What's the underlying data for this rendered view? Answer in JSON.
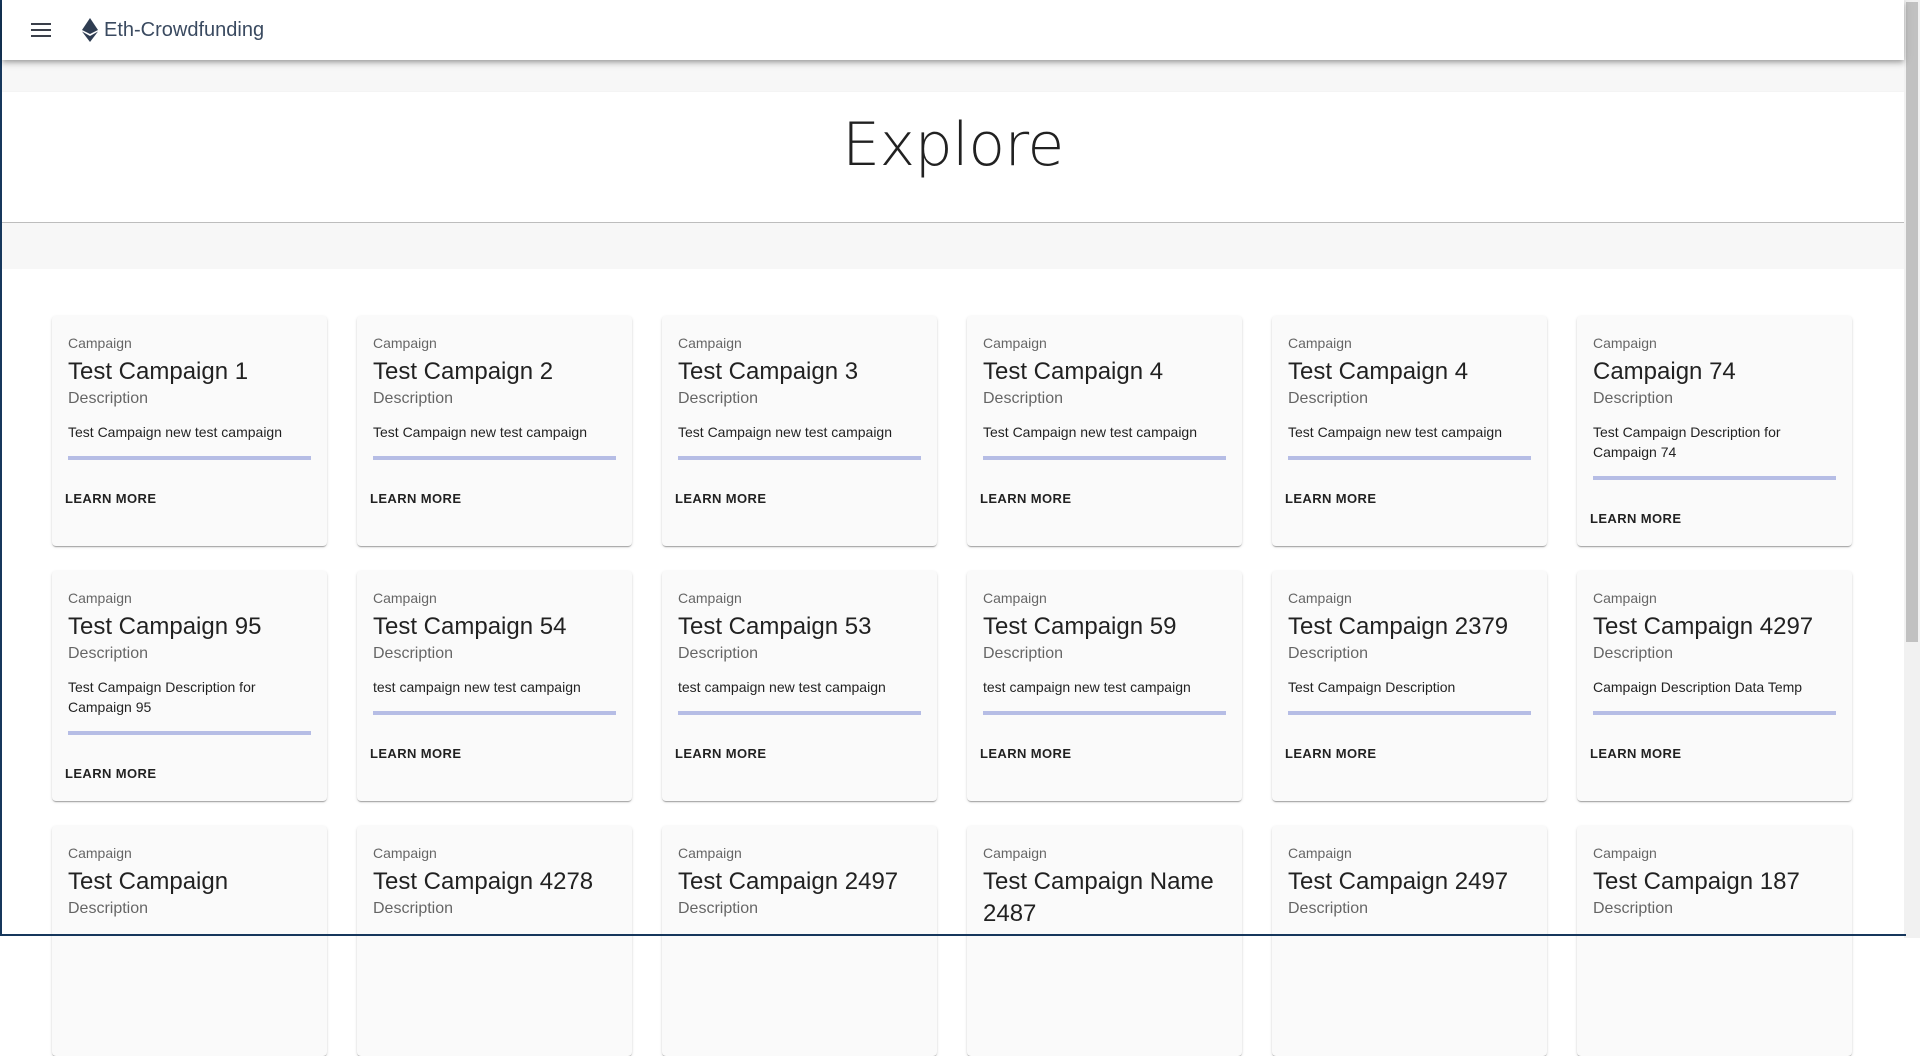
{
  "app": {
    "title": "Eth-Crowdfunding"
  },
  "hero": {
    "title": "Explore"
  },
  "cards": [
    {
      "overline": "Campaign",
      "title": "Test Campaign 1",
      "subtitle": "Description",
      "description": "Test Campaign new test campaign",
      "action": "LEARN MORE",
      "progress": 0
    },
    {
      "overline": "Campaign",
      "title": "Test Campaign 2",
      "subtitle": "Description",
      "description": "Test Campaign new test campaign",
      "action": "LEARN MORE",
      "progress": 0
    },
    {
      "overline": "Campaign",
      "title": "Test Campaign 3",
      "subtitle": "Description",
      "description": "Test Campaign new test campaign",
      "action": "LEARN MORE",
      "progress": 0
    },
    {
      "overline": "Campaign",
      "title": "Test Campaign 4",
      "subtitle": "Description",
      "description": "Test Campaign new test campaign",
      "action": "LEARN MORE",
      "progress": 0
    },
    {
      "overline": "Campaign",
      "title": "Test Campaign 4",
      "subtitle": "Description",
      "description": "Test Campaign new test campaign",
      "action": "LEARN MORE",
      "progress": 0
    },
    {
      "overline": "Campaign",
      "title": "Campaign 74",
      "subtitle": "Description",
      "description": "Test Campaign Description for Campaign 74",
      "action": "LEARN MORE",
      "progress": 0
    },
    {
      "overline": "Campaign",
      "title": "Test Campaign 95",
      "subtitle": "Description",
      "description": "Test Campaign Description for Campaign 95",
      "action": "LEARN MORE",
      "progress": 0
    },
    {
      "overline": "Campaign",
      "title": "Test Campaign 54",
      "subtitle": "Description",
      "description": "test campaign new test campaign",
      "action": "LEARN MORE",
      "progress": 0
    },
    {
      "overline": "Campaign",
      "title": "Test Campaign 53",
      "subtitle": "Description",
      "description": "test campaign new test campaign",
      "action": "LEARN MORE",
      "progress": 0
    },
    {
      "overline": "Campaign",
      "title": "Test Campaign 59",
      "subtitle": "Description",
      "description": "test campaign new test campaign",
      "action": "LEARN MORE",
      "progress": 0
    },
    {
      "overline": "Campaign",
      "title": "Test Campaign 2379",
      "subtitle": "Description",
      "description": "Test Campaign Description",
      "action": "LEARN MORE",
      "progress": 0
    },
    {
      "overline": "Campaign",
      "title": "Test Campaign 4297",
      "subtitle": "Description",
      "description": "Campaign Description Data Temp",
      "action": "LEARN MORE",
      "progress": 0
    },
    {
      "overline": "Campaign",
      "title": "Test Campaign",
      "subtitle": "Description",
      "description": "",
      "action": "",
      "progress": 0
    },
    {
      "overline": "Campaign",
      "title": "Test Campaign 4278",
      "subtitle": "Description",
      "description": "",
      "action": "",
      "progress": 0
    },
    {
      "overline": "Campaign",
      "title": "Test Campaign 2497",
      "subtitle": "Description",
      "description": "",
      "action": "",
      "progress": 0
    },
    {
      "overline": "Campaign",
      "title": "Test Campaign Name 2487",
      "subtitle": "",
      "description": "",
      "action": "",
      "progress": 0
    },
    {
      "overline": "Campaign",
      "title": "Test Campaign 2497",
      "subtitle": "Description",
      "description": "",
      "action": "",
      "progress": 0
    },
    {
      "overline": "Campaign",
      "title": "Test Campaign 187",
      "subtitle": "Description",
      "description": "",
      "action": "",
      "progress": 0
    }
  ],
  "colors": {
    "progress_track": "#b6bde5",
    "progress_fill": "#3f51b5",
    "card_bg": "#fafafa",
    "brand_text": "#3a4a60"
  },
  "icons": {
    "menu": "hamburger-menu-icon",
    "brand": "ethereum-icon"
  }
}
